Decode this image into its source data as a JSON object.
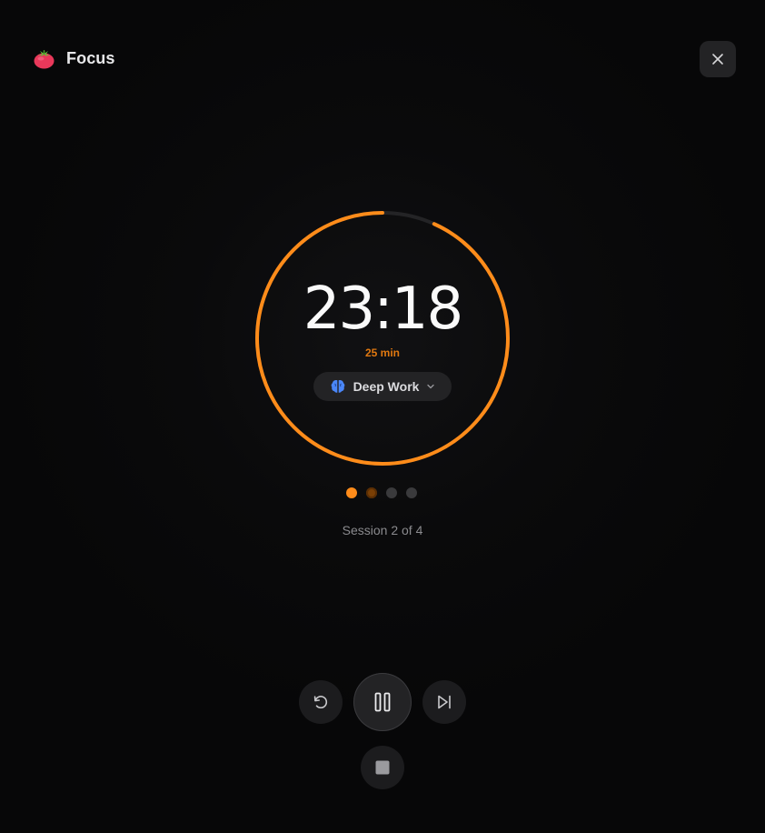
{
  "header": {
    "title": "Focus",
    "logo_icon": "tomato-icon",
    "close_icon": "close-icon"
  },
  "timer": {
    "time_display": "23:18",
    "duration_label": "25 min",
    "progress_remaining": 0.932,
    "accent_color": "#ff8c1a",
    "track_color": "#242426"
  },
  "mode": {
    "label": "Deep Work",
    "icon": "brain-icon",
    "icon_color": "#4a86f7",
    "dropdown_icon": "chevron-down-icon"
  },
  "sessions": {
    "text": "Session 2 of 4",
    "states": [
      "done",
      "current",
      "pending",
      "pending"
    ]
  },
  "controls": {
    "reset_icon": "reset-icon",
    "pause_icon": "pause-icon",
    "skip_icon": "skip-next-icon",
    "stop_icon": "stop-icon"
  }
}
